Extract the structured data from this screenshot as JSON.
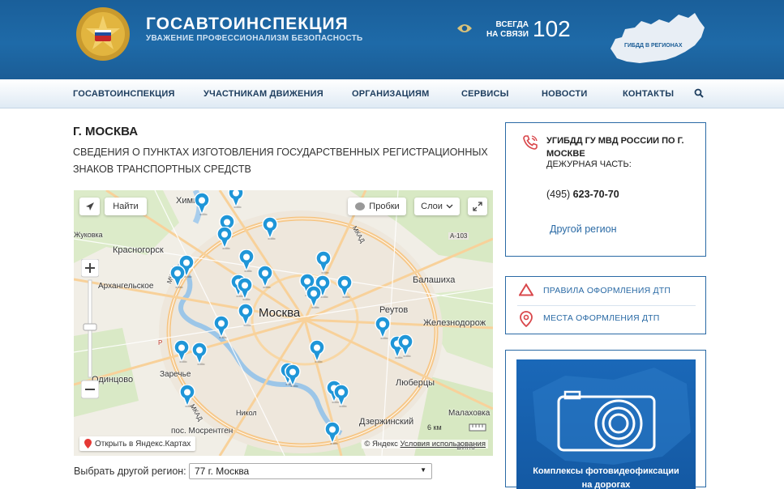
{
  "header": {
    "title": "ГОСАВТОИНСПЕКЦИЯ",
    "subtitle": "УВАЖЕНИЕ ПРОФЕССИОНАЛИЗМ БЕЗОПАСНОСТЬ",
    "always_line1": "ВСЕГДА",
    "always_line2": "НА СВЯЗИ",
    "hotline": "102",
    "regions_label": "ГИБДД В РЕГИОНАХ"
  },
  "nav": {
    "items": [
      "ГОСАВТОИНСПЕКЦИЯ",
      "УЧАСТНИКАМ ДВИЖЕНИЯ",
      "ОРГАНИЗАЦИЯМ",
      "СЕРВИСЫ",
      "НОВОСТИ",
      "КОНТАКТЫ"
    ]
  },
  "main": {
    "title": "Г. МОСКВА",
    "subtitle": "СВЕДЕНИЯ О ПУНКТАХ ИЗГОТОВЛЕНИЯ ГОСУДАРСТВЕННЫХ РЕГИСТРАЦИОННЫХ ЗНАКОВ ТРАНСПОРТНЫХ СРЕДСТВ"
  },
  "map": {
    "find_button": "Найти",
    "traffic_button": "Пробки",
    "layers_button": "Слои",
    "open_yandex": "Открыть в Яндекс.Картах",
    "copyright": "© Яндекс",
    "terms": "Условия использования",
    "scale": "6 км",
    "labels": {
      "khimki": "Химки",
      "krasnogorsk": "Красногорск",
      "arkhangelskoe": "Архангельское",
      "moskva": "Москва",
      "balashikha": "Балашиха",
      "reutov": "Реутов",
      "zheleznodorozhny": "Железнодорож",
      "lyubertsy": "Люберцы",
      "odintsovo": "Одинцово",
      "zarechye": "Заречье",
      "dzerzhinsky": "Дзержинский",
      "malakhovka": "Малаховка",
      "mosrentgen": "пос. Мосрентген",
      "vinogradovo": "Вино",
      "mkad1": "МКАД",
      "mkad2": "МКАД",
      "mkad3": "МКАД",
      "a103": "A-103",
      "nikoly": "Никол",
      "zhukovka": "Жуковка",
      "r1": "Р"
    }
  },
  "region_select": {
    "label": "Выбрать другой регион:",
    "value": "77 г. Москва"
  },
  "contact": {
    "department": "УГИБДД ГУ МВД РОССИИ ПО Г. МОСКВЕ",
    "duty": "ДЕЖУРНАЯ ЧАСТЬ:",
    "phone_code": "(495)",
    "phone_number": "623-70-70",
    "other_region": "Другой регион"
  },
  "links": {
    "rules": "ПРАВИЛА ОФОРМЛЕНИЯ ДТП",
    "places": "МЕСТА ОФОРМЛЕНИЯ ДТП"
  },
  "banner": {
    "line1": "Комплексы фотовидеофиксации",
    "line2": "на дорогах"
  },
  "colors": {
    "header_blue": "#1e6aa8",
    "link_blue": "#2a6aa5",
    "pin_blue": "#1f96d8",
    "icon_red": "#d9474b"
  }
}
